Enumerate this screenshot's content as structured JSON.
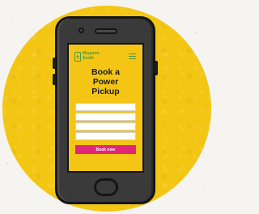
{
  "illustration": {
    "background_color": "#f6f4f0",
    "disc_color": "#f3c614"
  },
  "phone": {
    "body_color": "#3a3a3a",
    "outline_color": "#151515",
    "screen": {
      "background_color": "#f5c515",
      "logo": {
        "text": "Megaton\nSmith",
        "color": "#4e9c3a"
      },
      "menu_icon": "hamburger-menu-icon",
      "heading_lines": [
        "Book a",
        "Power",
        "Pickup"
      ],
      "form_fields": [
        {
          "value": ""
        },
        {
          "value": ""
        },
        {
          "value": ""
        },
        {
          "value": ""
        }
      ],
      "book_button": {
        "label": "Book now",
        "color": "#e1267a"
      }
    }
  }
}
